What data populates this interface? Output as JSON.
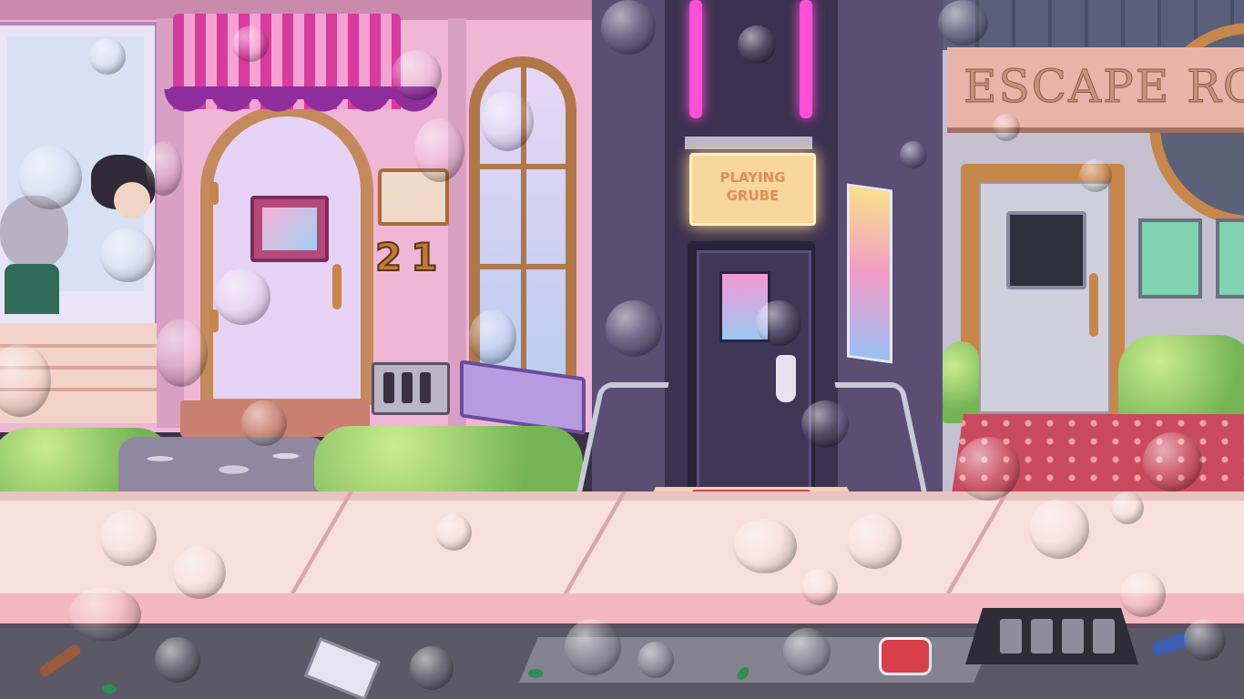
{
  "scene": {
    "left_shop": {
      "house_number": "21"
    },
    "middle_building": {
      "neon_sign_text": "PLAYING\nGRUBE"
    },
    "right_shop": {
      "banner_text": "ESCAPE RO"
    },
    "colors": {
      "neon_pink": "#ff4fd8",
      "shop_pink": "#efb6d6",
      "dark_building": "#4a3f61",
      "sidewalk": "#f7dfdb",
      "street": "#5b5965"
    },
    "icons": [
      "door-icon",
      "neon-sign-icon",
      "drain-grate-icon",
      "soda-can-icon"
    ]
  }
}
